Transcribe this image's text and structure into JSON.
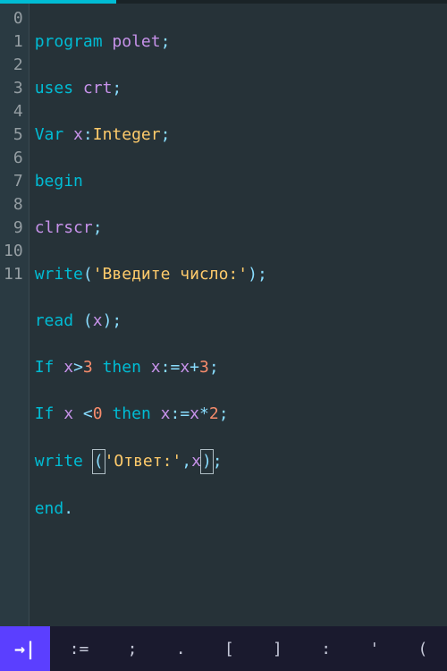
{
  "gutter": [
    "0",
    "1",
    "2",
    "3",
    "4",
    "5",
    "6",
    "7",
    "8",
    "9",
    "10",
    "11"
  ],
  "code": {
    "l0": {
      "kw": "program",
      "id": "polet",
      "semi": ";"
    },
    "l1": {
      "kw": "uses",
      "id": "crt",
      "semi": ";"
    },
    "l2": {
      "kw": "Var",
      "id": "x",
      "colon": ":",
      "type": "Integer",
      "semi": ";"
    },
    "l3": {
      "kw": "begin"
    },
    "l4": {
      "id": "clrscr",
      "semi": ";"
    },
    "l5": {
      "fn": "write",
      "lp": "(",
      "str": "'Введите число:'",
      "rp": ")",
      "semi": ";"
    },
    "l6": {
      "fn": "read",
      "sp": " ",
      "lp": "(",
      "id": "x",
      "rp": ")",
      "semi": ";"
    },
    "l7": {
      "kw1": "If",
      "id1": "x",
      "op1": ">",
      "n1": "3",
      "kw2": "then",
      "id2": "x",
      "op2": ":=",
      "id3": "x",
      "op3": "+",
      "n2": "3",
      "semi": ";"
    },
    "l8": {
      "kw1": "If",
      "id1": "x",
      "sp": " ",
      "op1": "<",
      "n1": "0",
      "kw2": "then",
      "id2": "x",
      "op2": ":=",
      "id3": "x",
      "op3": "*",
      "n2": "2",
      "semi": ";"
    },
    "l9": {
      "fn": "write",
      "sp": " ",
      "lp": "(",
      "str": "'Ответ:'",
      "comma": ",",
      "id": "x",
      "rp": ")",
      "semi": ";"
    },
    "l10": {
      "kw": "end",
      "dot": "."
    }
  },
  "toolbar": {
    "tab_icon": "→|",
    "symbols": [
      ":=",
      ";",
      ".",
      "[",
      "]",
      ":",
      "'",
      "("
    ]
  }
}
